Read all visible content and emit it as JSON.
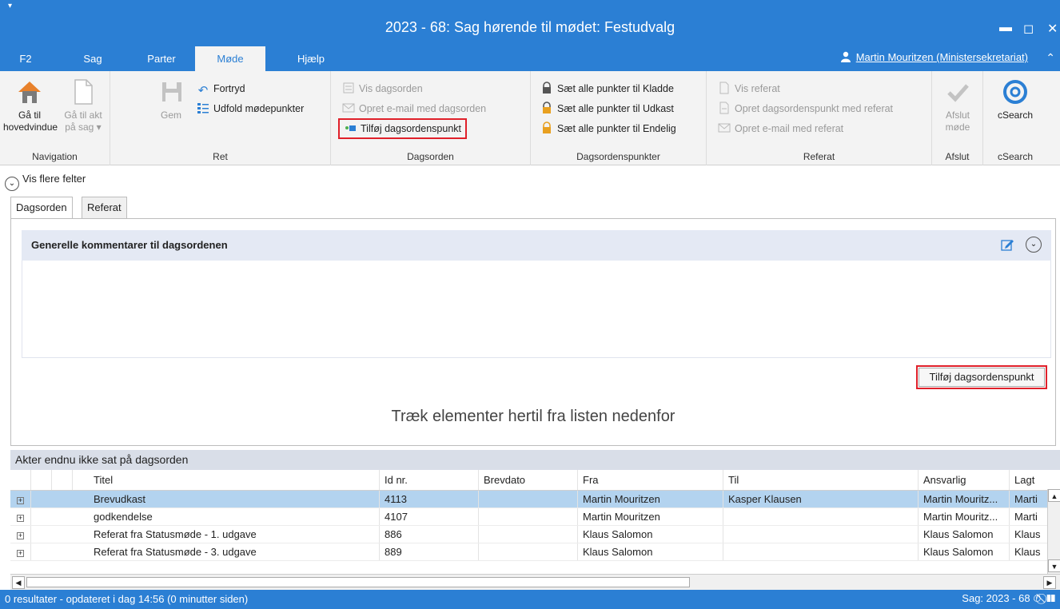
{
  "window": {
    "title": "2023 - 68: Sag hørende til mødet: Festudvalg",
    "sysmenu_glyph": "▾",
    "minimize_glyph": "▬",
    "maximize_glyph": "◻",
    "close_glyph": "✕"
  },
  "ribbon_tabs": [
    "F2",
    "Sag",
    "Parter",
    "Møde",
    "Hjælp"
  ],
  "active_tab": "Møde",
  "user": {
    "name": "Martin Mouritzen (Ministersekretariat)"
  },
  "ribbon_collapse_glyph": "⌃",
  "ribbon": {
    "navigation": {
      "label": "Navigation",
      "home_line1": "Gå til",
      "home_line2": "hovedvindue",
      "akt_line1": "Gå til akt",
      "akt_line2": "på sag ▾"
    },
    "ret": {
      "label": "Ret",
      "gem": "Gem",
      "fortryd": "Fortryd",
      "udfold": "Udfold mødepunkter"
    },
    "dagsorden": {
      "label": "Dagsorden",
      "vis": "Vis dagsorden",
      "email": "Opret e-mail med dagsorden",
      "tilfoej": "Tilføj dagsordenspunkt"
    },
    "dagsordenspunkter": {
      "label": "Dagsordenspunkter",
      "kladde": "Sæt alle punkter til Kladde",
      "udkast": "Sæt alle punkter til Udkast",
      "endelig": "Sæt alle punkter til Endelig"
    },
    "referat": {
      "label": "Referat",
      "vis": "Vis referat",
      "opret": "Opret dagsordenspunkt med referat",
      "email": "Opret e-mail med referat"
    },
    "afslut": {
      "label": "Afslut",
      "line1": "Afslut",
      "line2": "møde"
    },
    "csearch": {
      "label": "cSearch",
      "btn": "cSearch"
    }
  },
  "more_fields": {
    "glyph": "⌄",
    "label": "Vis flere felter"
  },
  "page_tabs": [
    "Dagsorden",
    "Referat"
  ],
  "comments": {
    "title": "Generelle kommentarer til dagsordenen",
    "collapse_glyph": "⌄"
  },
  "add_button": "Tilføj dagsordenspunkt",
  "drop_hint": "Træk elementer hertil fra listen nedenfor",
  "grid": {
    "title": "Akter endnu ikke sat på dagsorden",
    "columns": [
      "Titel",
      "Id nr.",
      "Brevdato",
      "Fra",
      "Til",
      "Ansvarlig",
      "Lagt"
    ],
    "expand_glyph": "+",
    "rows": [
      [
        "Brevudkast",
        "4113",
        "",
        "Martin Mouritzen",
        "Kasper Klausen",
        "Martin Mouritz...",
        "Marti"
      ],
      [
        "godkendelse",
        "4107",
        "",
        "Martin Mouritzen",
        "",
        "Martin Mouritz...",
        "Marti"
      ],
      [
        "Referat fra Statusmøde - 1. udgave",
        "886",
        "",
        "Klaus Salomon",
        "",
        "Klaus Salomon",
        "Klaus"
      ],
      [
        "Referat fra Statusmøde - 3. udgave",
        "889",
        "",
        "Klaus Salomon",
        "",
        "Klaus Salomon",
        "Klaus"
      ]
    ],
    "scroll_up": "▲",
    "scroll_down": "▼",
    "scroll_left": "◀",
    "scroll_right": "▶"
  },
  "status": {
    "left": "0 resultater - opdateret i dag 14:56 (0 minutter siden)",
    "right": "Sag: 2023 - 68 ⏱ ⃠ ❚❚"
  },
  "colors": {
    "accent": "#2b7fd4",
    "highlight": "#e0202a",
    "selected_row": "#b3d3ef"
  }
}
